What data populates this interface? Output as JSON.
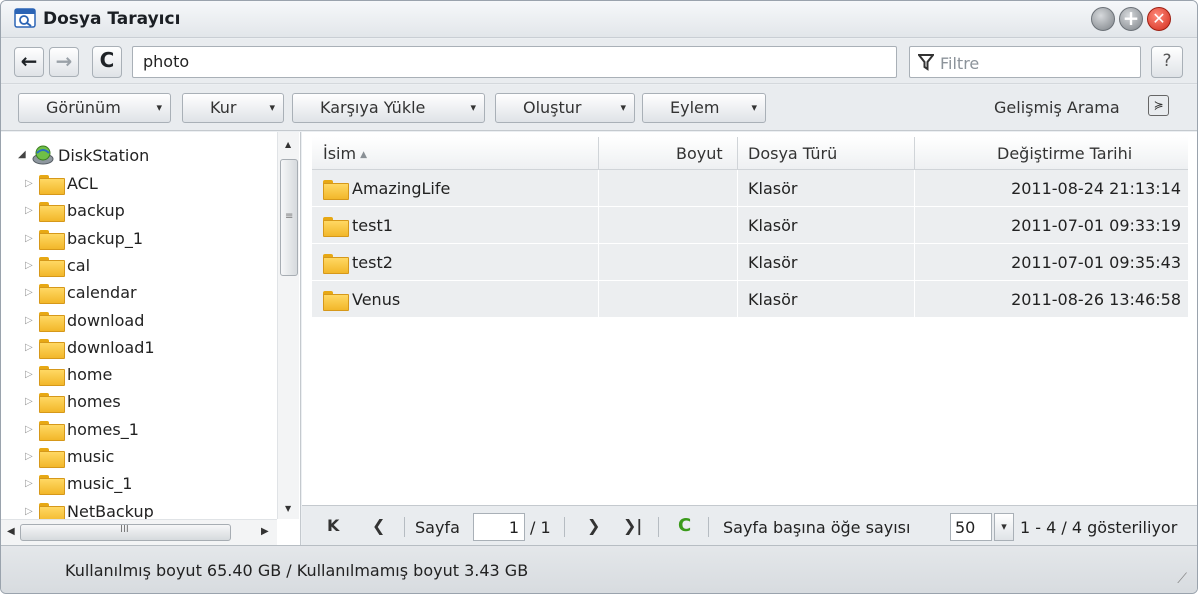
{
  "window": {
    "title": "Dosya Tarayıcı",
    "icons": {
      "app": "file-browser-icon",
      "minimize": "minimize-icon",
      "maximize": "maximize-icon",
      "close": "close-icon"
    }
  },
  "address_bar": {
    "back_icon": "←",
    "forward_icon": "→",
    "refresh_icon": "C",
    "path": "photo",
    "filter_placeholder": "Filtre",
    "help_label": "?"
  },
  "toolbar": {
    "view_label": "Görünüm",
    "setup_label": "Kur",
    "upload_label": "Karşıya Yükle",
    "create_label": "Oluştur",
    "action_label": "Eylem",
    "advanced_search_label": "Gelişmiş Arama",
    "dropdown_glyph": "▾",
    "advanced_search_glyph": "≽"
  },
  "tree": {
    "root_label": "DiskStation",
    "root_expander": "◢",
    "item_expander": "▷",
    "items": [
      {
        "label": "ACL"
      },
      {
        "label": "backup"
      },
      {
        "label": "backup_1"
      },
      {
        "label": "cal"
      },
      {
        "label": "calendar"
      },
      {
        "label": "download"
      },
      {
        "label": "download1"
      },
      {
        "label": "home"
      },
      {
        "label": "homes"
      },
      {
        "label": "homes_1"
      },
      {
        "label": "music"
      },
      {
        "label": "music_1"
      },
      {
        "label": "NetBackup"
      }
    ],
    "scroll": {
      "up": "▲",
      "down": "▼",
      "left": "◀",
      "right": "▶",
      "grip_vertical": "≡",
      "grip_horizontal": "III"
    }
  },
  "grid": {
    "columns": {
      "name": "İsim",
      "size": "Boyut",
      "type": "Dosya Türü",
      "modified": "Değiştirme Tarihi",
      "sort_glyph": "▲"
    },
    "rows": [
      {
        "name": "AmazingLife",
        "size": "",
        "type": "Klasör",
        "modified": "2011-08-24 21:13:14"
      },
      {
        "name": "test1",
        "size": "",
        "type": "Klasör",
        "modified": "2011-07-01 09:33:19"
      },
      {
        "name": "test2",
        "size": "",
        "type": "Klasör",
        "modified": "2011-07-01 09:35:43"
      },
      {
        "name": "Venus",
        "size": "",
        "type": "Klasör",
        "modified": "2011-08-26 13:46:58"
      }
    ]
  },
  "pager": {
    "first_icon": "K",
    "prev_icon": "❮",
    "next_icon": "❯",
    "last_icon": "❯|",
    "page_label": "Sayfa",
    "page_value": "1",
    "page_total": "/ 1",
    "refresh_icon": "C",
    "per_page_label": "Sayfa başına öğe sayısı",
    "per_page_value": "50",
    "per_page_arrow": "▾",
    "display_info": "1 - 4 / 4 gösteriliyor"
  },
  "status": {
    "text": "Kullanılmış boyut 65.40 GB / Kullanılmamış boyut 3.43 GB",
    "resize_glyph": "⟋"
  },
  "colors": {
    "accent_folder": "#f2b72a",
    "close_button": "#d22b1b",
    "refresh_green": "#3a9a1a",
    "row_background": "#eceef0"
  }
}
